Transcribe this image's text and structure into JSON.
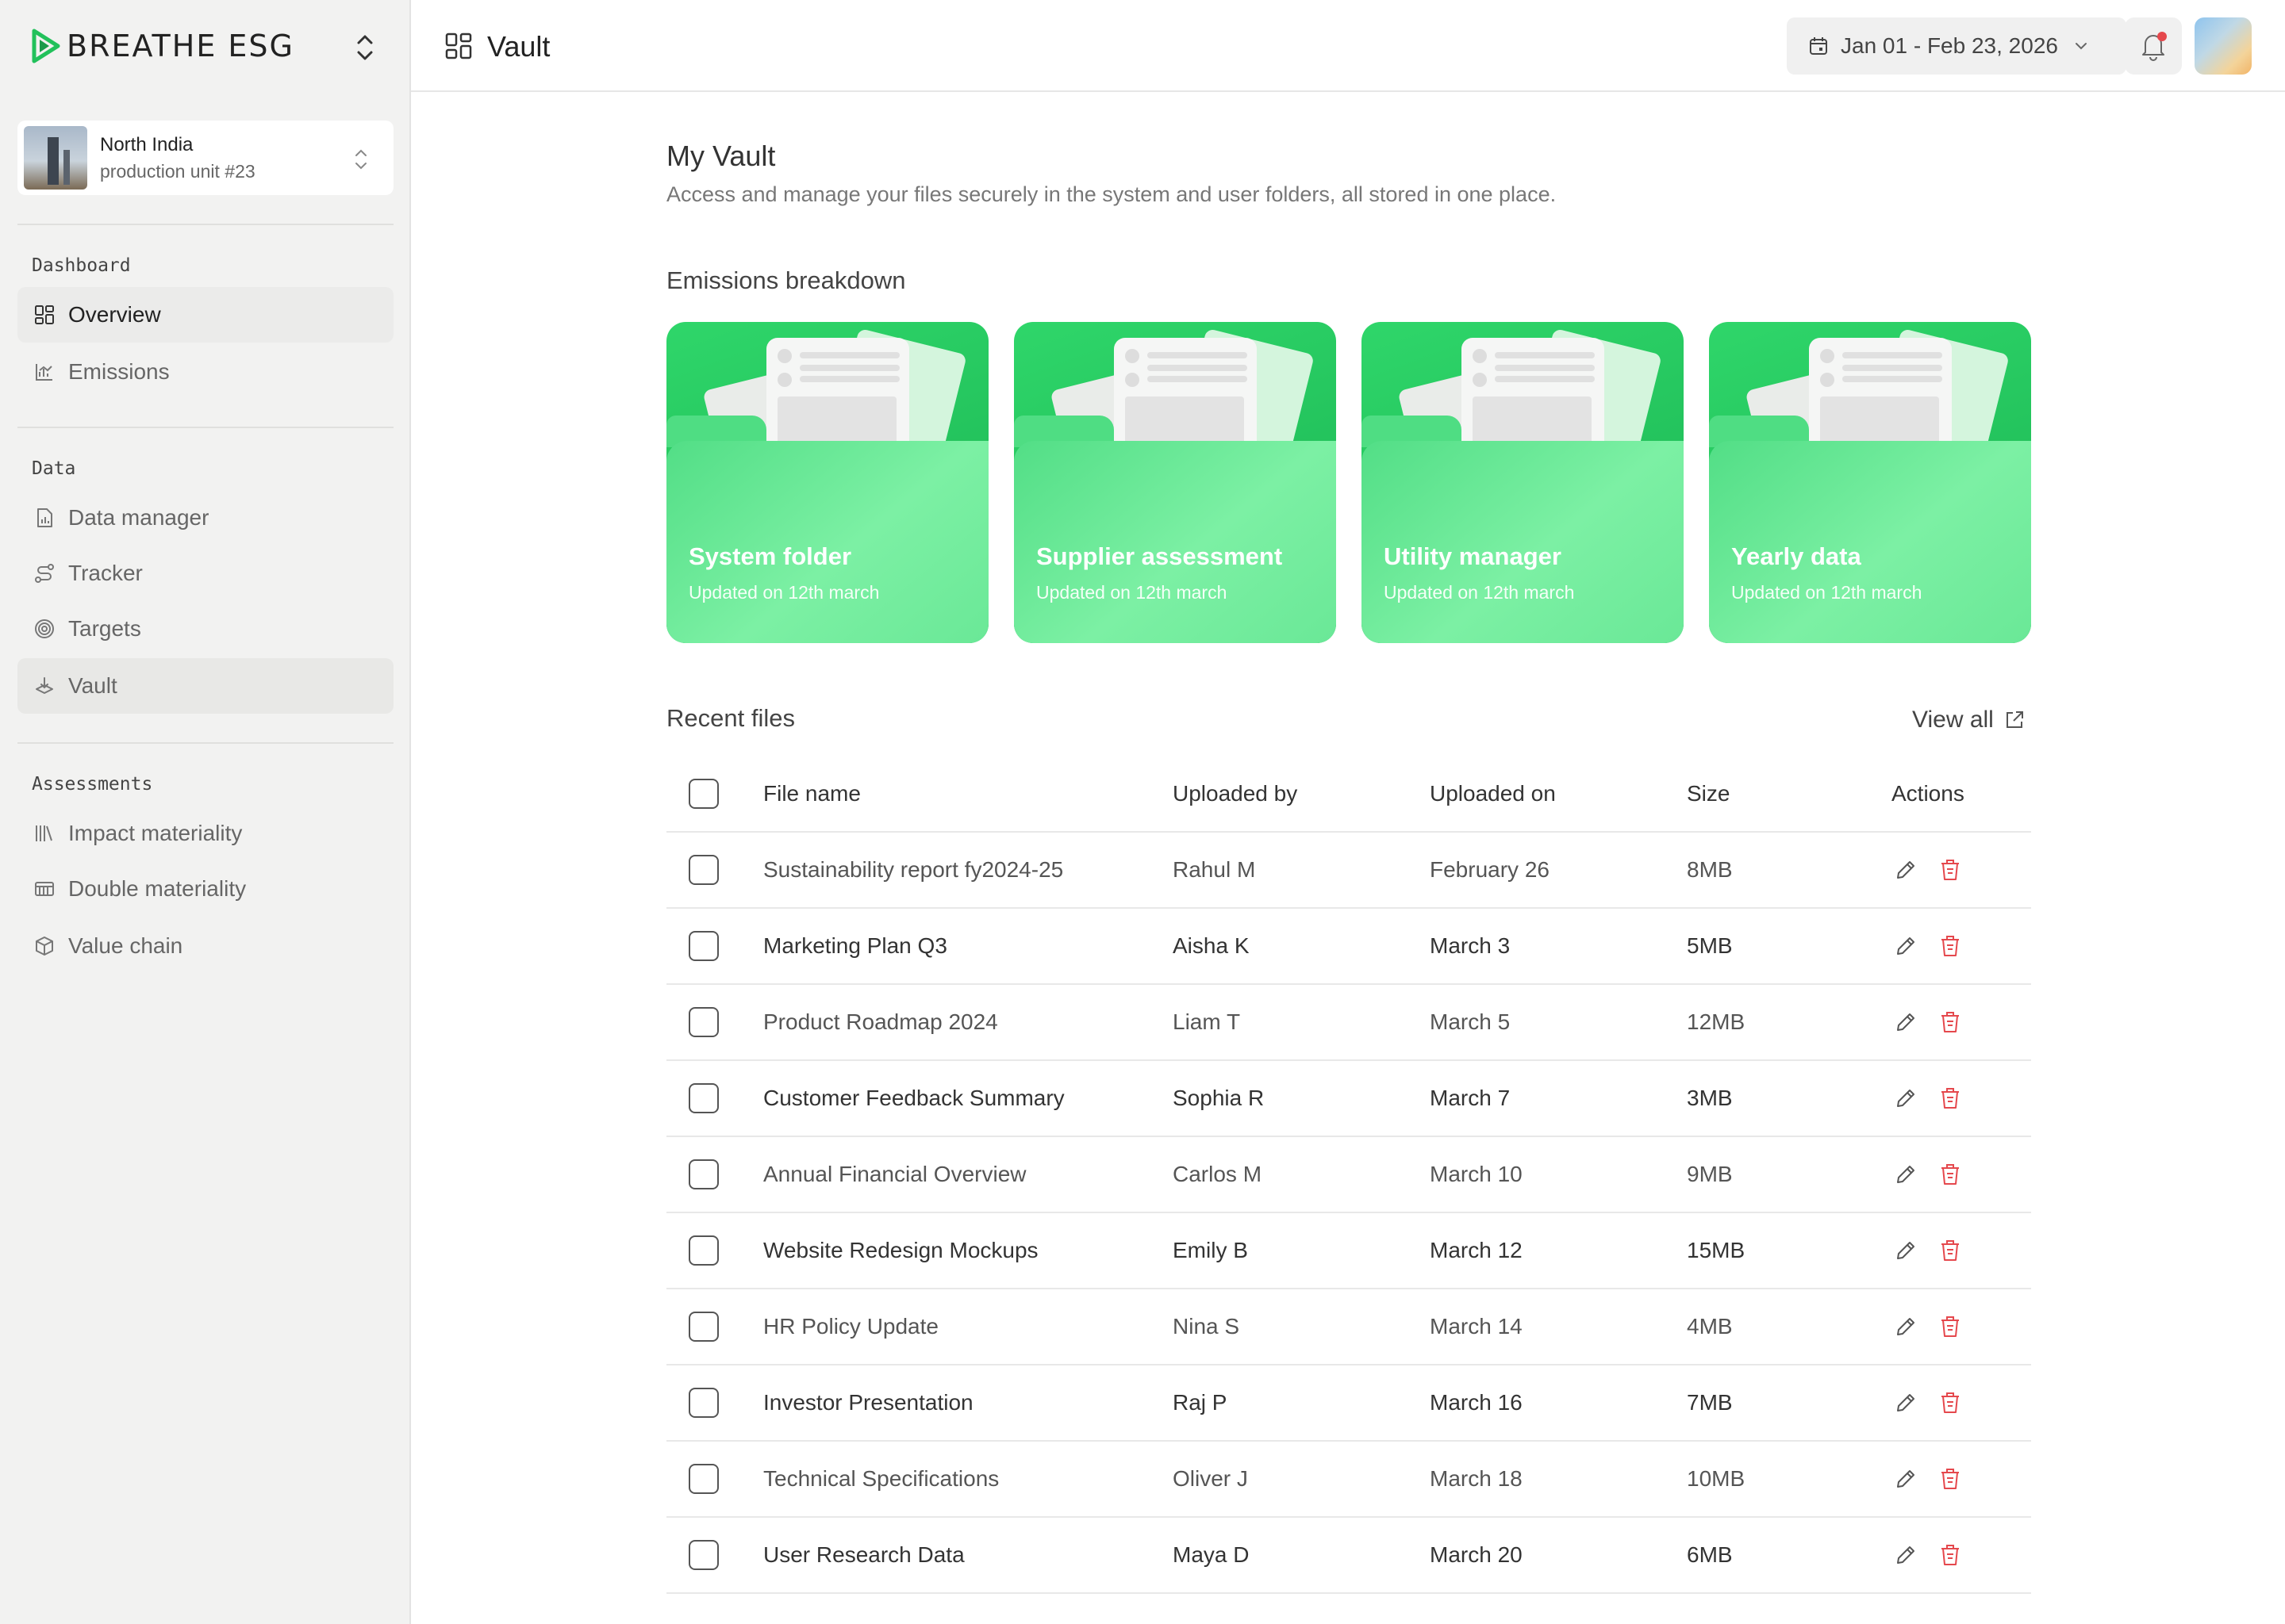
{
  "brand": {
    "name": "BREATHE ESG",
    "accent": "#22c15b"
  },
  "site": {
    "name": "North India",
    "subtitle": "production unit #23"
  },
  "nav": {
    "sections": [
      {
        "heading": "Dashboard",
        "items": [
          {
            "label": "Overview",
            "icon": "grid-icon"
          },
          {
            "label": "Emissions",
            "icon": "chart-icon"
          }
        ]
      },
      {
        "heading": "Data",
        "items": [
          {
            "label": "Data manager",
            "icon": "document-chart-icon"
          },
          {
            "label": "Tracker",
            "icon": "route-icon"
          },
          {
            "label": "Targets",
            "icon": "target-icon"
          },
          {
            "label": "Vault",
            "icon": "vault-icon"
          }
        ]
      },
      {
        "heading": "Assessments",
        "items": [
          {
            "label": "Impact materiality",
            "icon": "books-icon"
          },
          {
            "label": "Double materiality",
            "icon": "table-icon"
          },
          {
            "label": "Value chain",
            "icon": "box-icon"
          }
        ]
      }
    ]
  },
  "topbar": {
    "title": "Vault",
    "date_range": "Jan 01 - Feb 23, 2026",
    "notification_dot_color": "#e5484d"
  },
  "main": {
    "title": "My Vault",
    "subtitle": "Access and manage your files securely in the system and user folders, all stored in one place.",
    "folders_heading": "Emissions breakdown",
    "folders": [
      {
        "title": "System folder",
        "updated": "Updated on 12th march"
      },
      {
        "title": "Supplier assessment",
        "updated": "Updated on 12th march"
      },
      {
        "title": "Utility manager",
        "updated": "Updated on 12th march"
      },
      {
        "title": "Yearly data",
        "updated": "Updated on 12th march"
      }
    ],
    "recent_heading": "Recent files",
    "view_all": "View all",
    "table": {
      "columns": [
        "File name",
        "Uploaded by",
        "Uploaded on",
        "Size",
        "Actions"
      ],
      "rows": [
        {
          "name": "Sustainability report fy2024-25",
          "by": "Rahul M",
          "on": "February 26",
          "size": "8MB"
        },
        {
          "name": "Marketing Plan Q3",
          "by": "Aisha K",
          "on": "March 3",
          "size": "5MB"
        },
        {
          "name": "Product Roadmap 2024",
          "by": "Liam T",
          "on": "March 5",
          "size": "12MB"
        },
        {
          "name": "Customer Feedback Summary",
          "by": "Sophia R",
          "on": "March 7",
          "size": "3MB"
        },
        {
          "name": "Annual Financial Overview",
          "by": "Carlos M",
          "on": "March 10",
          "size": "9MB"
        },
        {
          "name": "Website Redesign Mockups",
          "by": "Emily B",
          "on": "March 12",
          "size": "15MB"
        },
        {
          "name": "HR Policy Update",
          "by": "Nina S",
          "on": "March 14",
          "size": "4MB"
        },
        {
          "name": "Investor Presentation",
          "by": "Raj P",
          "on": "March 16",
          "size": "7MB"
        },
        {
          "name": "Technical Specifications",
          "by": "Oliver J",
          "on": "March 18",
          "size": "10MB"
        },
        {
          "name": "User Research Data",
          "by": "Maya D",
          "on": "March 20",
          "size": "6MB"
        }
      ]
    },
    "delete_color": "#e5484d"
  }
}
